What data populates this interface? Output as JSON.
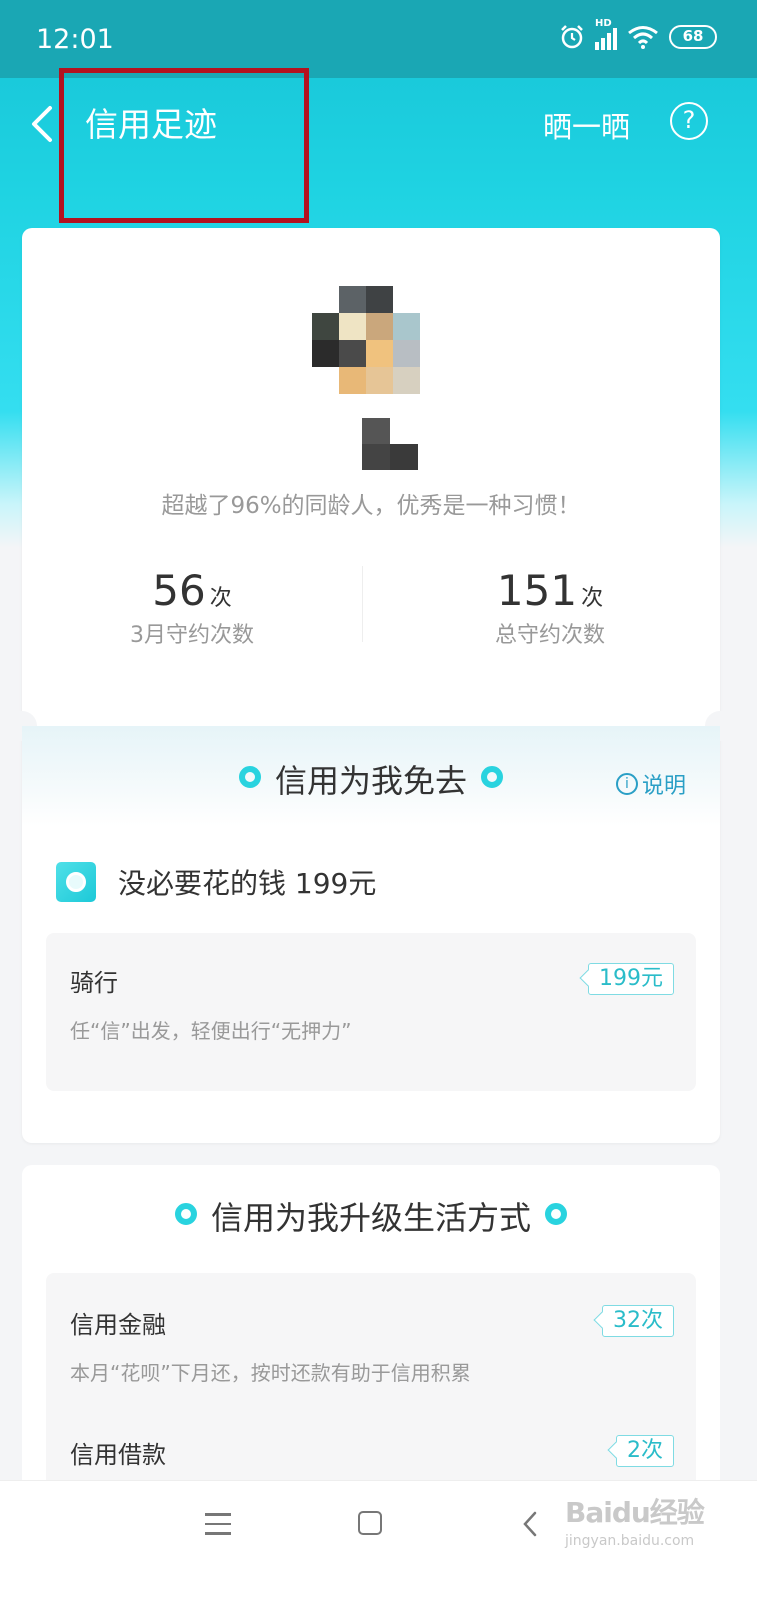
{
  "status_bar": {
    "time": "12:01",
    "battery": "68",
    "network_label": "HD"
  },
  "nav": {
    "title": "信用足迹",
    "share_label": "晒一晒",
    "help_label": "?"
  },
  "profile": {
    "subtitle": "超越了96%的同龄人，优秀是一种习惯！",
    "stats": [
      {
        "value": "56",
        "unit": "次",
        "label": "3月守约次数"
      },
      {
        "value": "151",
        "unit": "次",
        "label": "总守约次数"
      }
    ]
  },
  "section_free": {
    "title": "信用为我免去",
    "explain_label": "说明",
    "explain_icon": "i",
    "saved_label": "没必要花的钱 199元",
    "items": [
      {
        "title": "骑行",
        "tag": "199元",
        "desc": "任“信”出发，轻便出行“无押力”"
      }
    ]
  },
  "section_upgrade": {
    "title": "信用为我升级生活方式",
    "items": [
      {
        "title": "信用金融",
        "tag": "32次",
        "desc": "本月“花呗”下月还，按时还款有助于信用积累"
      },
      {
        "title": "信用借款",
        "tag": "2次"
      }
    ]
  },
  "watermark": {
    "main": "Baidu经验",
    "sub": "jingyan.baidu.com"
  },
  "colors": {
    "accent": "#29d3df",
    "header": "#1aa7b4",
    "highlight": "#b3121f",
    "link": "#2a9fc6"
  },
  "icons": [
    "alarm-icon",
    "signal-icon",
    "wifi-icon",
    "back-icon",
    "help-icon",
    "coin-icon",
    "info-icon",
    "menu-icon",
    "home-icon",
    "nav-back-icon"
  ]
}
